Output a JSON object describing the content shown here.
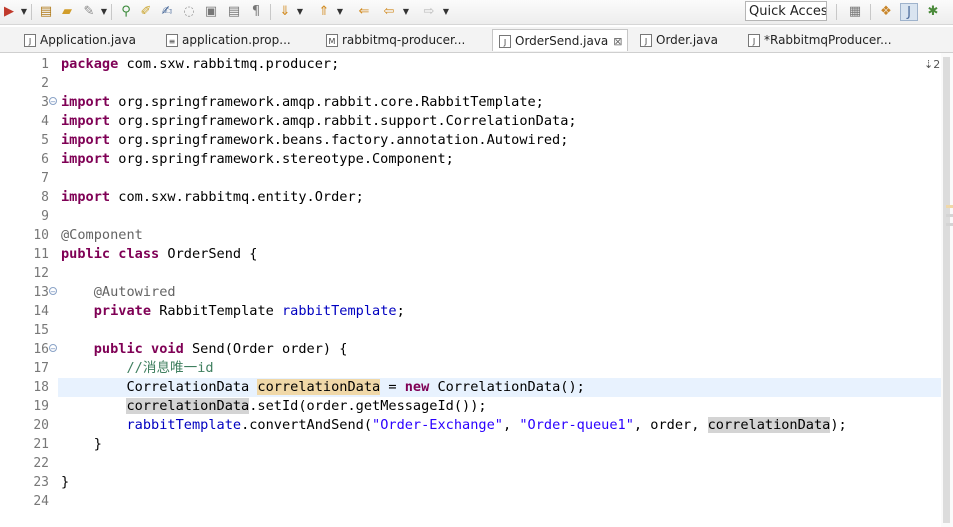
{
  "toolbar": {
    "quick_access_placeholder": "Quick Access",
    "icons": [
      "run-icon",
      "new-package-icon",
      "open-folder-icon",
      "wrench-icon",
      "pin-icon",
      "highlight-icon",
      "toggle-comment-icon",
      "block-selection-icon",
      "whitespace-icon",
      "format-icon",
      "next-annotation-icon",
      "previous-annotation-icon",
      "back-icon",
      "navigate-back-icon",
      "forward-icon",
      "open-perspective-icon",
      "java-ee-perspective-icon",
      "java-perspective-icon",
      "debug-perspective-icon"
    ]
  },
  "tabs": [
    {
      "label": "Application.java",
      "icon": "java-file-icon",
      "active": false
    },
    {
      "label": "application.prop...",
      "icon": "properties-file-icon",
      "active": false
    },
    {
      "label": "rabbitmq-producer...",
      "icon": "maven-pom-icon",
      "active": false
    },
    {
      "label": "OrderSend.java",
      "icon": "java-file-icon",
      "active": true,
      "close_icon": "close-icon"
    },
    {
      "label": "Order.java",
      "icon": "java-file-icon",
      "active": false
    },
    {
      "label": "*RabbitmqProducer...",
      "icon": "java-file-icon",
      "active": false
    }
  ],
  "tab_overflow": "2",
  "editor": {
    "current_line": 18,
    "lines": [
      {
        "n": "1",
        "fold": false,
        "segs": [
          {
            "t": "package",
            "c": "kw"
          },
          {
            "t": " com.sxw.rabbitmq.producer;"
          }
        ]
      },
      {
        "n": "2",
        "fold": false,
        "segs": []
      },
      {
        "n": "3",
        "fold": true,
        "segs": [
          {
            "t": "import",
            "c": "kw"
          },
          {
            "t": " org.springframework.amqp.rabbit.core.RabbitTemplate;"
          }
        ]
      },
      {
        "n": "4",
        "fold": false,
        "segs": [
          {
            "t": "import",
            "c": "kw"
          },
          {
            "t": " org.springframework.amqp.rabbit.support.CorrelationData;"
          }
        ]
      },
      {
        "n": "5",
        "fold": false,
        "segs": [
          {
            "t": "import",
            "c": "kw"
          },
          {
            "t": " org.springframework.beans.factory.annotation.Autowired;"
          }
        ]
      },
      {
        "n": "6",
        "fold": false,
        "segs": [
          {
            "t": "import",
            "c": "kw"
          },
          {
            "t": " org.springframework.stereotype.Component;"
          }
        ]
      },
      {
        "n": "7",
        "fold": false,
        "segs": []
      },
      {
        "n": "8",
        "fold": false,
        "segs": [
          {
            "t": "import",
            "c": "kw"
          },
          {
            "t": " com.sxw.rabbitmq.entity.Order;"
          }
        ]
      },
      {
        "n": "9",
        "fold": false,
        "segs": []
      },
      {
        "n": "10",
        "fold": false,
        "segs": [
          {
            "t": "@Component",
            "c": "ann"
          }
        ]
      },
      {
        "n": "11",
        "fold": false,
        "segs": [
          {
            "t": "public",
            "c": "kw"
          },
          {
            "t": " "
          },
          {
            "t": "class",
            "c": "kw"
          },
          {
            "t": " OrderSend {"
          }
        ]
      },
      {
        "n": "12",
        "fold": false,
        "segs": []
      },
      {
        "n": "13",
        "fold": true,
        "segs": [
          {
            "t": "    "
          },
          {
            "t": "@Autowired",
            "c": "ann"
          }
        ]
      },
      {
        "n": "14",
        "fold": false,
        "segs": [
          {
            "t": "    "
          },
          {
            "t": "private",
            "c": "kw"
          },
          {
            "t": " RabbitTemplate "
          },
          {
            "t": "rabbitTemplate",
            "c": "fld"
          },
          {
            "t": ";"
          }
        ]
      },
      {
        "n": "15",
        "fold": false,
        "segs": []
      },
      {
        "n": "16",
        "fold": true,
        "segs": [
          {
            "t": "    "
          },
          {
            "t": "public",
            "c": "kw"
          },
          {
            "t": " "
          },
          {
            "t": "void",
            "c": "kw"
          },
          {
            "t": " Send(Order order) {"
          }
        ]
      },
      {
        "n": "17",
        "fold": false,
        "segs": [
          {
            "t": "        "
          },
          {
            "t": "//消息唯一id",
            "c": "cmt"
          }
        ]
      },
      {
        "n": "18",
        "fold": false,
        "segs": [
          {
            "t": "        CorrelationData "
          },
          {
            "t": "correlationData",
            "c": "occ"
          },
          {
            "t": " = "
          },
          {
            "t": "new",
            "c": "kw"
          },
          {
            "t": " CorrelationData();"
          }
        ]
      },
      {
        "n": "19",
        "fold": false,
        "segs": [
          {
            "t": "        "
          },
          {
            "t": "correlationData",
            "c": "ref"
          },
          {
            "t": ".setId(order.getMessageId());"
          }
        ]
      },
      {
        "n": "20",
        "fold": false,
        "segs": [
          {
            "t": "        "
          },
          {
            "t": "rabbitTemplate",
            "c": "fld"
          },
          {
            "t": ".convertAndSend("
          },
          {
            "t": "\"Order-Exchange\"",
            "c": "str"
          },
          {
            "t": ", "
          },
          {
            "t": "\"Order-queue1\"",
            "c": "str"
          },
          {
            "t": ", order, "
          },
          {
            "t": "correlationData",
            "c": "ref"
          },
          {
            "t": ");"
          }
        ]
      },
      {
        "n": "21",
        "fold": false,
        "segs": [
          {
            "t": "    }"
          }
        ]
      },
      {
        "n": "22",
        "fold": false,
        "segs": []
      },
      {
        "n": "23",
        "fold": false,
        "segs": [
          {
            "t": "}"
          }
        ]
      },
      {
        "n": "24",
        "fold": false,
        "segs": []
      }
    ]
  },
  "colors": {
    "keyword": "#7f0055",
    "annotation": "#646464",
    "field": "#0000c0",
    "string": "#2a00ff",
    "comment": "#3f7f5f",
    "current_line": "#e8f2fe",
    "occurrence_write": "#f0d8a8",
    "occurrence_read": "#d4d4d4"
  }
}
